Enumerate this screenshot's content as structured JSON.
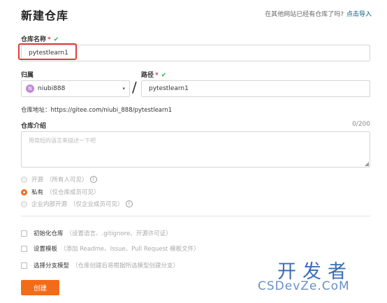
{
  "page": {
    "title": "新建仓库",
    "import_tip": "在其他网站已经有仓库了吗?",
    "import_link": "点击导入"
  },
  "repo_name": {
    "label": "仓库名称",
    "required_mark": "*",
    "check": "✔",
    "value": "pytestlearn1"
  },
  "owner": {
    "label": "归属",
    "avatar_letter": "N",
    "value": "niubi888",
    "caret": "▾"
  },
  "path": {
    "label": "路径",
    "required_mark": "*",
    "check": "✔",
    "separator": "/",
    "value": "pytestlearn1"
  },
  "address": "仓库地址：https://gitee.com/niubi_888/pytestlearn1",
  "intro": {
    "label": "仓库介绍",
    "counter": "0/200",
    "placeholder": "用简短的语言来描述一下吧"
  },
  "visibility": {
    "options": [
      {
        "label": "开源",
        "hint": "（所有人可见）",
        "selected": false,
        "disabled": true
      },
      {
        "label": "私有",
        "hint": "（仅仓库成员可见）",
        "selected": true,
        "disabled": false
      },
      {
        "label": "企业内部开源",
        "hint": "（仅企业成员可见）",
        "selected": false,
        "disabled": true
      }
    ]
  },
  "options": [
    {
      "label": "初始化仓库",
      "hint": "（设置语言、.gitignore、开源许可证）"
    },
    {
      "label": "设置模板",
      "hint": "（添加 Readme、Issue、Pull Request 模板文件）"
    },
    {
      "label": "选择分支模型",
      "hint": "（仓库创建后将根据所选模型创建分支）"
    }
  ],
  "create_button": "创建",
  "watermark": {
    "big": "开发者",
    "small": "CSDevZe.CoM"
  }
}
